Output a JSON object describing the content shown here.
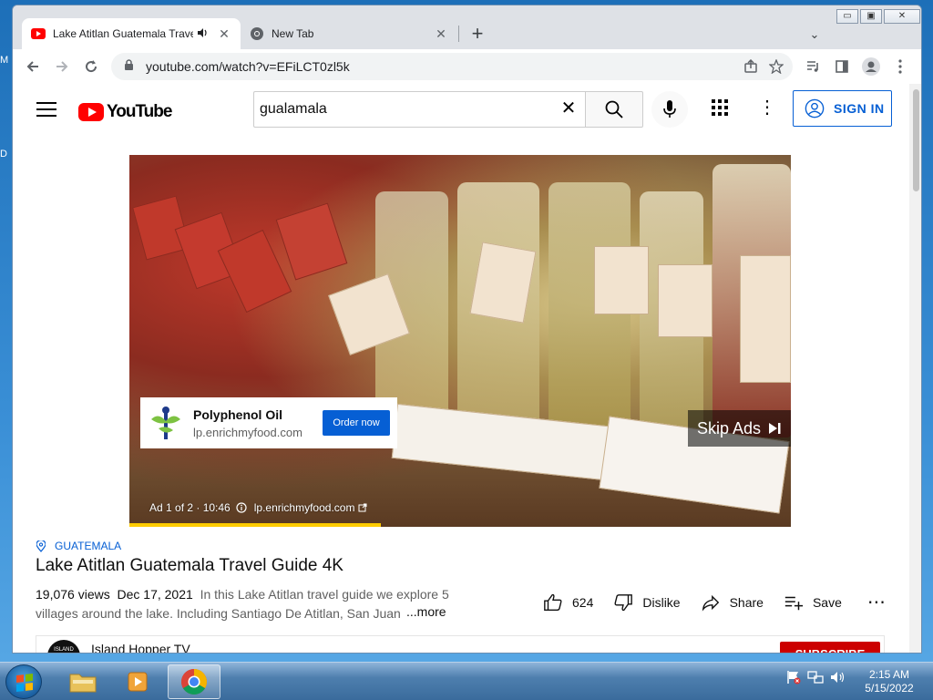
{
  "desktop": {
    "left_letters": [
      "M",
      "D"
    ]
  },
  "browser": {
    "tabs": [
      {
        "title": "Lake Atitlan Guatemala Trave",
        "active": true
      },
      {
        "title": "New Tab",
        "active": false
      }
    ],
    "url": "youtube.com/watch?v=EFiLCT0zl5k"
  },
  "youtube": {
    "logo_text": "YouTube",
    "search_value": "gualamala",
    "sign_in_label": "SIGN IN",
    "ad": {
      "title": "Polyphenol Oil",
      "url": "lp.enrichmyfood.com",
      "cta": "Order now",
      "skip_label": "Skip Ads",
      "info_count": "Ad 1 of 2 · 10:46",
      "info_url": "lp.enrichmyfood.com",
      "progress": 0.38
    },
    "video": {
      "location": "GUATEMALA",
      "title": "Lake Atitlan Guatemala Travel Guide 4K",
      "views": "19,076 views",
      "date": "Dec 17, 2021",
      "description": "In this Lake Atitlan travel guide we explore 5 villages around the lake. Including Santiago De Atitlan, San Juan",
      "more_label": "...more",
      "likes": "624",
      "dislike_label": "Dislike",
      "share_label": "Share",
      "save_label": "Save"
    },
    "channel": {
      "name": "Island Hopper TV",
      "avatar_text": "ISLAND HOPPER",
      "subscribe_label": "SUBSCRIBE"
    }
  },
  "taskbar": {
    "time": "2:15 AM",
    "date": "5/15/2022"
  },
  "colors": {
    "youtube_red": "#ff0000",
    "link_blue": "#065fd4",
    "ad_progress": "#ffcc00"
  }
}
